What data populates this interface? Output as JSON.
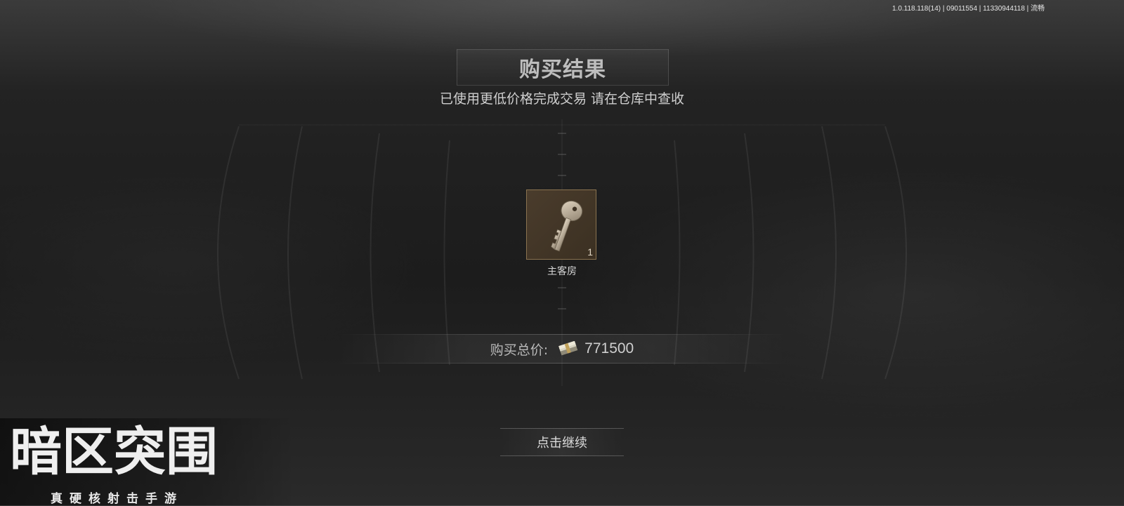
{
  "hud": {
    "version": "1.0.118.118(14) | 09011554 | 11330944118 | 流畅"
  },
  "dialog": {
    "title": "购买结果",
    "subtitle": "已使用更低价格完成交易 请在仓库中查收"
  },
  "item": {
    "name": "主客房",
    "quantity": "1",
    "icon": "key-icon",
    "slot_color": "#3f3325",
    "border_color": "#8a7350"
  },
  "price": {
    "label": "购买总价:",
    "value": "771500",
    "currency_icon": "cash-stack-icon"
  },
  "continue_button": {
    "label": "点击继续"
  },
  "logo": {
    "main_text": "暗区突围",
    "tagline": "真硬核射击手游"
  }
}
